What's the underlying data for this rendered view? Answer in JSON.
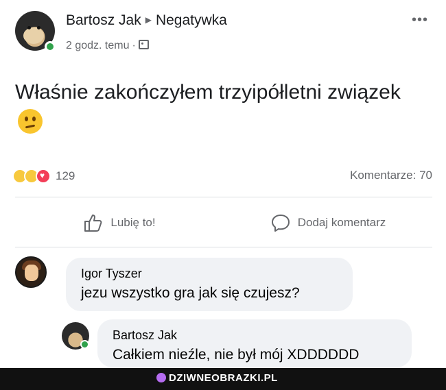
{
  "post": {
    "author": "Bartosz Jak",
    "group": "Negatywka",
    "time": "2 godz. temu",
    "separator": "·",
    "more_label": "•••",
    "body_text": "Właśnie zakończyłem trzyipółletni związek",
    "body_emoji": "confused-face-icon"
  },
  "stats": {
    "reactions": [
      "sad",
      "haha",
      "love"
    ],
    "reaction_count": "129",
    "comments_label": "Komentarze: 70"
  },
  "actions": {
    "like_label": "Lubię to!",
    "comment_label": "Dodaj komentarz"
  },
  "comments": [
    {
      "author": "Igor Tyszer",
      "text": "jezu wszystko gra jak się czujesz?"
    },
    {
      "author": "Bartosz Jak",
      "text": "Całkiem nieźle, nie był mój XDDDDDD"
    }
  ],
  "watermark": {
    "text": "DZIWNEOBRAZKI.PL"
  },
  "colors": {
    "text": "#1c1e21",
    "secondary": "#65676b",
    "bubble": "#f0f2f5",
    "online": "#31a24c",
    "love": "#f33e58",
    "emoji_yellow": "#f9c52e"
  }
}
